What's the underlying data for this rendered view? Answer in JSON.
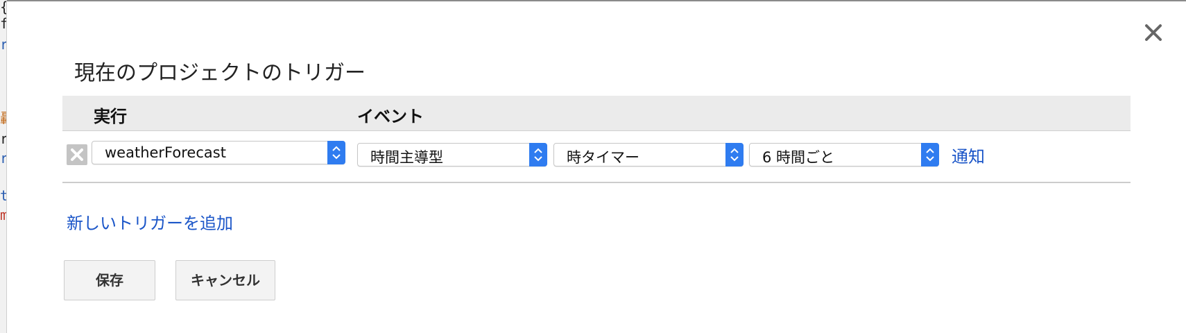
{
  "background_editor": {
    "chars": [
      {
        "text": "{",
        "color": "#222222"
      },
      {
        "text": "f",
        "color": "#222222"
      },
      {
        "text": "r",
        "color": "#2a5db0"
      },
      {
        "text": "轟",
        "color": "#c26a1a"
      },
      {
        "text": "r",
        "color": "#222222"
      },
      {
        "text": "r",
        "color": "#2a5db0"
      },
      {
        "text": "t",
        "color": "#2a5db0"
      },
      {
        "text": "m",
        "color": "#c0392b"
      }
    ]
  },
  "dialog": {
    "title": "現在のプロジェクトのトリガー",
    "close_icon": "close-icon"
  },
  "table": {
    "headers": {
      "run": "実行",
      "event": "イベント"
    },
    "rows": [
      {
        "function": "weatherForecast",
        "event_source": "時間主導型",
        "timer_type": "時タイマー",
        "interval": "6 時間ごと",
        "notify_label": "通知"
      }
    ]
  },
  "add_trigger_label": "新しいトリガーを追加",
  "buttons": {
    "save": "保存",
    "cancel": "キャンセル"
  },
  "colors": {
    "link": "#1a55c8",
    "select_arrow": "#2f7cf0",
    "header_bg": "#ebebeb"
  }
}
